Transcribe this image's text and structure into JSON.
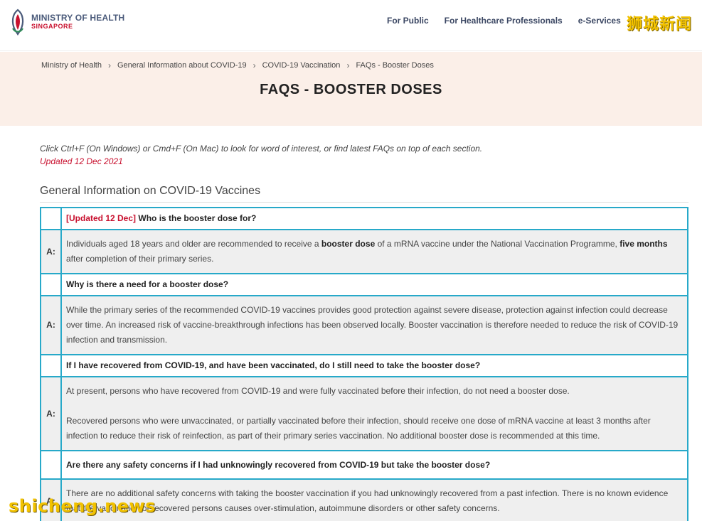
{
  "header": {
    "logo_line1": "MINISTRY OF HEALTH",
    "logo_line2": "SINGAPORE",
    "nav": [
      "For Public",
      "For Healthcare Professionals",
      "e-Services"
    ],
    "watermark": "狮城新闻"
  },
  "breadcrumb": [
    "Ministry of Health",
    "General Information about COVID-19",
    "COVID-19 Vaccination",
    "FAQs - Booster Doses"
  ],
  "page_title": "FAQS - BOOSTER DOSES",
  "intro": "Click Ctrl+F (On Windows) or Cmd+F (On Mac) to look for word of interest, or find latest FAQs on top of each section.",
  "updated": "Updated 12 Dec 2021",
  "section_title": "General Information on COVID-19 Vaccines",
  "answer_marker": "A:",
  "faq": {
    "q1": {
      "tag": "[Updated 12 Dec]",
      "text": "Who is the booster dose for?"
    },
    "a1": {
      "p1": "Individuals aged 18 years and older are recommended to receive a ",
      "b1": "booster dose",
      "p2": " of a mRNA vaccine under the National Vaccination Programme, ",
      "b2": "five months",
      "p3": " after completion of their primary series."
    },
    "q2": "Why is there a need for a booster dose?",
    "a2": "While the primary series of the recommended COVID-19 vaccines provides good protection against severe disease, protection against infection could decrease over time. An increased risk of vaccine-breakthrough infections has been observed locally. Booster vaccination is therefore needed to reduce the risk of COVID-19 infection and transmission.",
    "q3": "If I have recovered from COVID-19, and have been vaccinated, do I still need to take the booster dose?",
    "a3_p1": "At present, persons who have recovered from COVID-19 and were fully vaccinated before their infection, do not need a booster dose.",
    "a3_p2": "Recovered persons who were unvaccinated, or partially vaccinated before their infection, should receive one dose of mRNA vaccine at least 3 months after infection to reduce their risk of reinfection, as part of their primary series vaccination. No additional booster dose is recommended at this time.",
    "q4": "Are there any safety concerns if I had unknowingly recovered from COVID-19 but take the booster dose?",
    "a4": "There are no additional safety concerns with taking the booster vaccination if you had unknowingly recovered from a past infection. There is no known evidence that the vaccination of recovered persons causes over-stimulation, autoimmune disorders or other safety concerns."
  },
  "watermark_bottom": "shicheng.news"
}
